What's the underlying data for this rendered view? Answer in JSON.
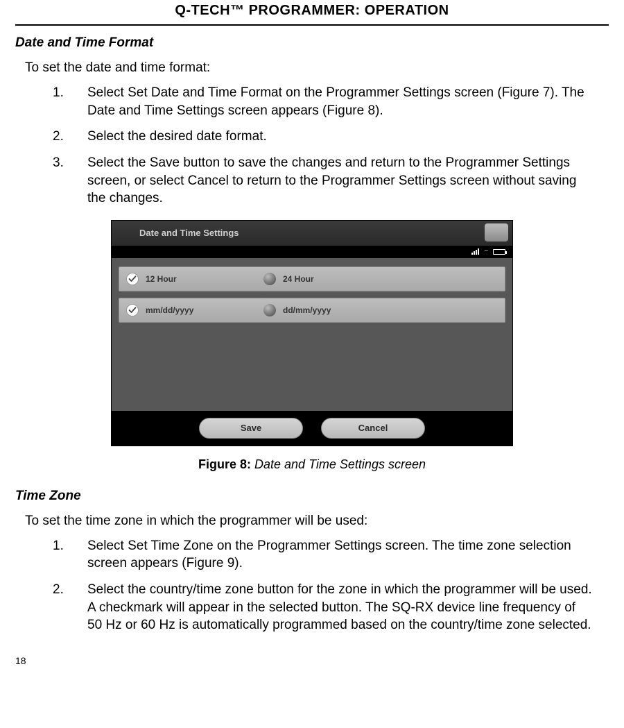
{
  "header": "Q-TECH™ PROGRAMMER:  OPERATION",
  "section1": {
    "title": "Date and Time Format",
    "intro": "To set the date and time format:",
    "steps": [
      "Select Set Date and Time Format on the Programmer Settings screen (Figure 7). The Date and Time Settings screen appears (Figure 8).",
      "Select the desired date format.",
      "Select the Save button to save the changes and return to the Programmer Settings screen, or select Cancel to return to the Programmer Settings screen without saving the changes."
    ]
  },
  "device": {
    "title": "Date and Time Settings",
    "row1": {
      "opt1": {
        "label": "12 Hour",
        "checked": true
      },
      "opt2": {
        "label": "24 Hour",
        "checked": false
      }
    },
    "row2": {
      "opt1": {
        "label": "mm/dd/yyyy",
        "checked": true
      },
      "opt2": {
        "label": "dd/mm/yyyy",
        "checked": false
      }
    },
    "buttons": {
      "save": "Save",
      "cancel": "Cancel"
    }
  },
  "caption": {
    "label": "Figure 8:",
    "text": " Date and Time Settings screen"
  },
  "section2": {
    "title": "Time Zone",
    "intro": "To set the time zone in which the programmer will be used:",
    "steps": [
      "Select Set Time Zone on the Programmer Settings screen. The time zone selection screen appears (Figure 9).",
      "Select the country/time zone button for the zone in which the programmer will be used. A checkmark will appear in the selected button. The SQ-RX device line frequency of 50 Hz or 60 Hz is automatically programmed based on the country/time zone selected."
    ]
  },
  "pageNumber": "18"
}
